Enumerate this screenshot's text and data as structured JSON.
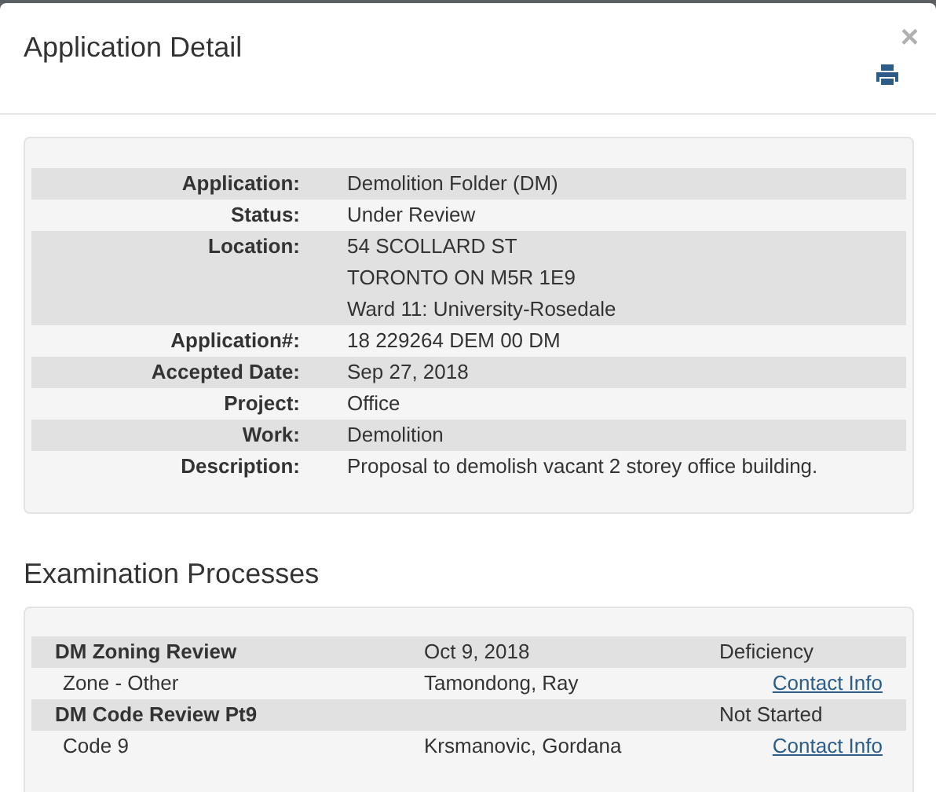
{
  "modal": {
    "title": "Application Detail",
    "close": "×"
  },
  "details": [
    {
      "label": "Application:",
      "lines": [
        "Demolition Folder (DM)"
      ]
    },
    {
      "label": "Status:",
      "lines": [
        "Under Review"
      ]
    },
    {
      "label": "Location:",
      "lines": [
        "54 SCOLLARD ST",
        "TORONTO ON M5R 1E9",
        "Ward 11: University-Rosedale"
      ]
    },
    {
      "label": "Application#:",
      "lines": [
        "18 229264 DEM 00 DM"
      ]
    },
    {
      "label": "Accepted Date:",
      "lines": [
        "Sep 27, 2018"
      ]
    },
    {
      "label": "Project:",
      "lines": [
        "Office"
      ]
    },
    {
      "label": "Work:",
      "lines": [
        "Demolition"
      ]
    },
    {
      "label": "Description:",
      "lines": [
        "Proposal to demolish vacant 2 storey office building."
      ]
    }
  ],
  "examination": {
    "heading": "Examination Processes",
    "processes": [
      {
        "name": "DM Zoning Review",
        "date": "Oct 9, 2018",
        "status": "Deficiency",
        "type": "Zone - Other",
        "examiner": "Tamondong, Ray",
        "link": "Contact Info"
      },
      {
        "name": "DM Code Review Pt9",
        "status": "Not Started",
        "type": "Code 9",
        "examiner": "Krsmanovic, Gordana",
        "link": "Contact Info"
      }
    ]
  }
}
